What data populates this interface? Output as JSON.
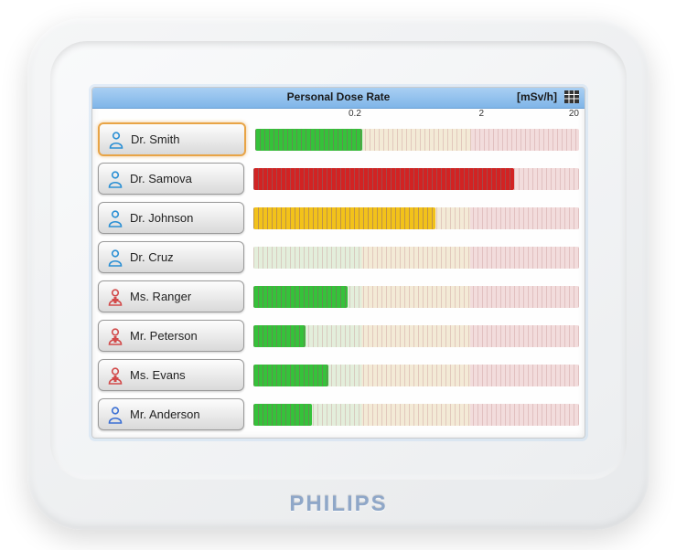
{
  "brand": "PHILIPS",
  "header": {
    "title": "Personal Dose Rate",
    "unit": "[mSv/h]"
  },
  "scale": {
    "tick1": "0.2",
    "tick2": "2",
    "tick3": "20"
  },
  "colors": {
    "zone_low": "#e3eedb",
    "zone_mid": "#f3ead6",
    "zone_high": "#f2dcdc",
    "bar_green": "#35c23a",
    "bar_yellow": "#f2c21a",
    "bar_red": "#d22323",
    "selected_border": "#e8a446"
  },
  "chart_data": {
    "type": "bar",
    "title": "Personal Dose Rate",
    "xlabel": "",
    "ylabel": "mSv/h",
    "x_scale": "log",
    "x_ticks": [
      0.02,
      0.2,
      2,
      20
    ],
    "zones": [
      {
        "from": 0.02,
        "to": 0.2,
        "color": "green"
      },
      {
        "from": 0.2,
        "to": 2,
        "color": "yellow"
      },
      {
        "from": 2,
        "to": 20,
        "color": "red"
      }
    ],
    "series": [
      {
        "name": "Dr. Smith",
        "value": 0.2,
        "level": "green",
        "role": "doctor",
        "selected": true,
        "bar_percent": 33
      },
      {
        "name": "Dr. Samova",
        "value": 5.0,
        "level": "red",
        "role": "doctor",
        "selected": false,
        "bar_percent": 80
      },
      {
        "name": "Dr. Johnson",
        "value": 1.0,
        "level": "yellow",
        "role": "doctor",
        "selected": false,
        "bar_percent": 56
      },
      {
        "name": "Dr. Cruz",
        "value": 0.0,
        "level": "green",
        "role": "doctor",
        "selected": false,
        "bar_percent": 0
      },
      {
        "name": "Ms. Ranger",
        "value": 0.15,
        "level": "green",
        "role": "nurse",
        "selected": false,
        "bar_percent": 29
      },
      {
        "name": "Mr. Peterson",
        "value": 0.06,
        "level": "green",
        "role": "nurse",
        "selected": false,
        "bar_percent": 16
      },
      {
        "name": "Ms. Evans",
        "value": 0.1,
        "level": "green",
        "role": "nurse",
        "selected": false,
        "bar_percent": 23
      },
      {
        "name": "Mr. Anderson",
        "value": 0.07,
        "level": "green",
        "role": "tech",
        "selected": false,
        "bar_percent": 18
      }
    ]
  },
  "icons": {
    "doctor_color": "#2a8fd4",
    "nurse_color": "#d24a4a",
    "tech_color": "#3a6fd4"
  }
}
